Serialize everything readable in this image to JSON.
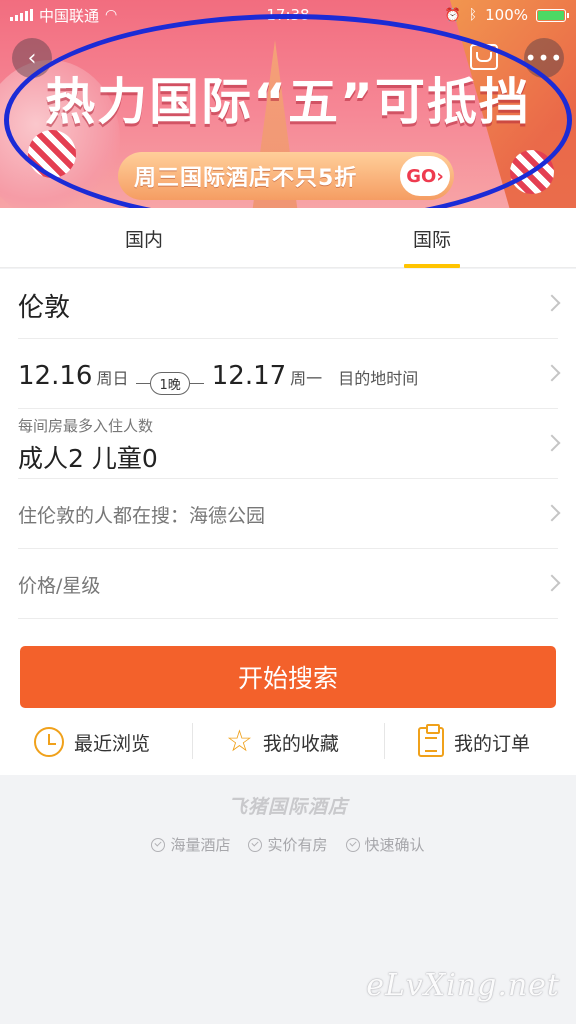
{
  "status_bar": {
    "carrier": "中国联通",
    "time": "17:38",
    "battery": "100%",
    "battery_level": 1.0
  },
  "banner": {
    "title": "热力国际“五”可抵挡",
    "promo_text": "周三国际酒店不只5折",
    "go_label": "GO›",
    "back_icon": "back-chevron-icon",
    "more_icon": "more-dots-icon",
    "gift_icon": "gift-box-icon",
    "annotation_color": "#1b2bd6"
  },
  "tabs": [
    {
      "label": "国内",
      "active": false
    },
    {
      "label": "国际",
      "active": true
    }
  ],
  "form": {
    "city": "伦敦",
    "checkin_date": "12.16",
    "checkin_day": "周日",
    "nights": "1晚",
    "checkout_date": "12.17",
    "checkout_day": "周一",
    "timezone_note": "目的地时间",
    "guests_label": "每间房最多入住人数",
    "guests_value": "成人2 儿童0",
    "popular_search": "住伦敦的人都在搜：海德公园",
    "price_star_placeholder": "价格/星级"
  },
  "search_button": {
    "label": "开始搜索",
    "color": "#f3612b"
  },
  "quick_links": [
    {
      "label": "最近浏览",
      "icon": "clock-icon"
    },
    {
      "label": "我的收藏",
      "icon": "star-icon"
    },
    {
      "label": "我的订单",
      "icon": "clipboard-icon"
    }
  ],
  "footer": {
    "brand": "飞猪国际酒店",
    "features": [
      "海量酒店",
      "实价有房",
      "快速确认"
    ]
  },
  "watermark": "eLvXing.net"
}
